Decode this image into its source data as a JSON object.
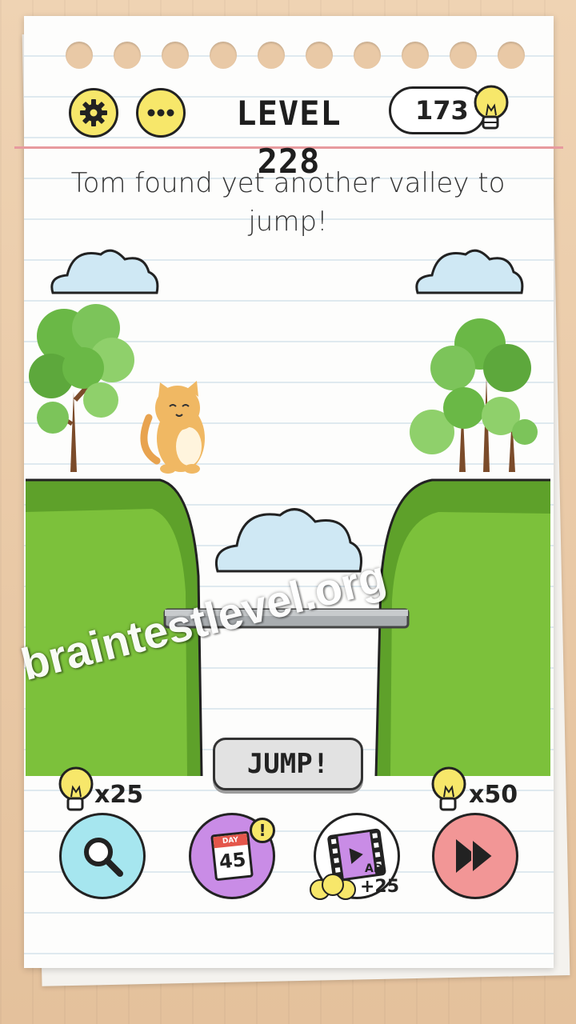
{
  "header": {
    "level_label": "LEVEL 228",
    "coins": "173"
  },
  "question": "Tom found yet another valley to jump!",
  "scene": {
    "jump_label": "JUMP!"
  },
  "footer": {
    "hint_cost": "x25",
    "skip_cost": "x50",
    "daily_day_label": "DAY",
    "daily_day_number": "45",
    "daily_badge": "!",
    "video_label": "AD",
    "video_reward": "+25"
  },
  "watermark": "braintestlevel.org",
  "colors": {
    "grass": "#7cc13b",
    "grass_dark": "#5ea12a",
    "cloud": "#cfe8f4",
    "button_yellow": "#f7e76a",
    "hint_blue": "#a6e6ef",
    "daily_purple": "#c98ce6",
    "skip_pink": "#f29696"
  }
}
